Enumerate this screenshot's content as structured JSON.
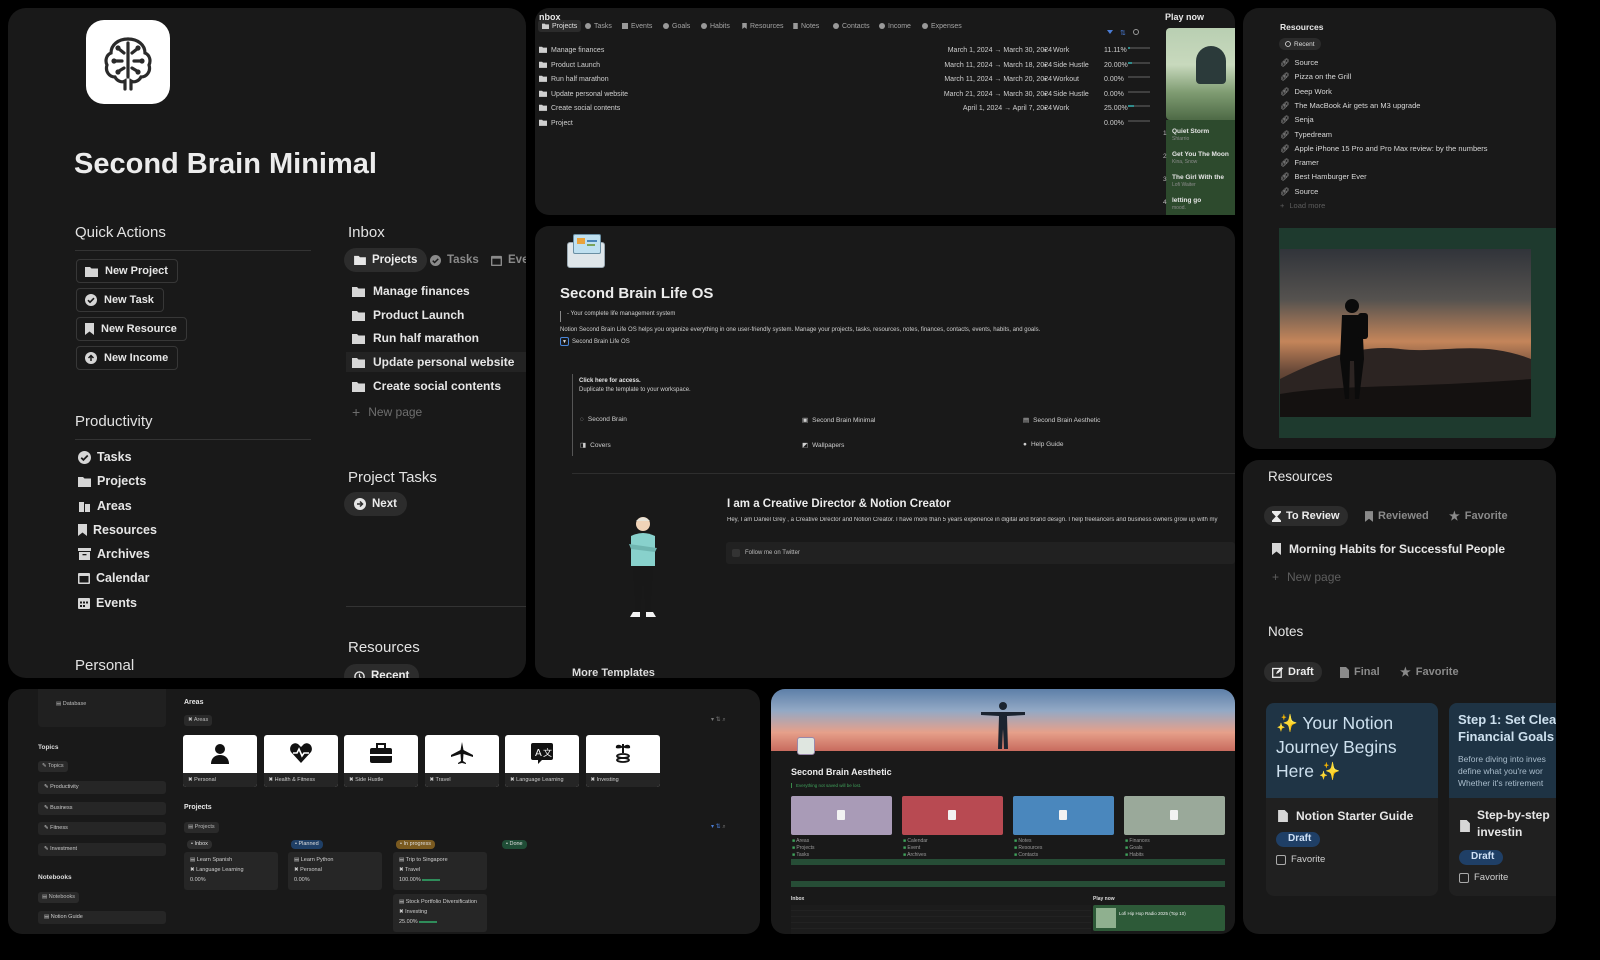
{
  "panel1": {
    "title": "Second Brain Minimal",
    "quick_actions": {
      "heading": "Quick Actions",
      "items": [
        "New Project",
        "New Task",
        "New Resource",
        "New Income"
      ]
    },
    "productivity": {
      "heading": "Productivity",
      "items": [
        "Tasks",
        "Projects",
        "Areas",
        "Resources",
        "Archives",
        "Calendar",
        "Events"
      ]
    },
    "personal_heading": "Personal",
    "inbox": {
      "heading": "Inbox",
      "tabs": [
        "Projects",
        "Tasks",
        "Ever"
      ],
      "items": [
        "Manage finances",
        "Product Launch",
        "Run half marathon",
        "Update personal website",
        "Create social contents"
      ],
      "new_page": "New page"
    },
    "project_tasks": {
      "heading": "Project Tasks",
      "button": "Next"
    },
    "resources": {
      "heading": "Resources",
      "button": "Recent"
    }
  },
  "panel2": {
    "title": "nbox",
    "tabs": [
      "Projects",
      "Tasks",
      "Events",
      "Goals",
      "Habits",
      "Resources",
      "Notes",
      "Contacts",
      "Income",
      "Expenses"
    ],
    "rows": [
      {
        "name": "Manage finances",
        "dates": "March 1, 2024 → March 30, 2024",
        "tag": "Work",
        "pct": "11.11%",
        "p": 11.11
      },
      {
        "name": "Product Launch",
        "dates": "March 11, 2024 → March 18, 2024",
        "tag": "Side Hustle",
        "pct": "20.00%",
        "p": 20
      },
      {
        "name": "Run half marathon",
        "dates": "March 11, 2024 → March 20, 2024",
        "tag": "Workout",
        "pct": "0.00%",
        "p": 0
      },
      {
        "name": "Update personal website",
        "dates": "March 21, 2024 → March 30, 2024",
        "tag": "Side Hustle",
        "pct": "0.00%",
        "p": 0
      },
      {
        "name": "Create social contents",
        "dates": "April 1, 2024 → April 7, 2024",
        "tag": "Work",
        "pct": "25.00%",
        "p": 25
      },
      {
        "name": "Project",
        "dates": "",
        "tag": "",
        "pct": "0.00%",
        "p": 0
      }
    ],
    "play_now": "Play now",
    "songs": [
      {
        "num": "1",
        "title": "Quiet Storm",
        "artist": "Shiarrio"
      },
      {
        "num": "2",
        "title": "Get You The Moon",
        "artist": "Kina, Snow"
      },
      {
        "num": "3",
        "title": "The Girl With the",
        "artist": "Lofi Waiter"
      },
      {
        "num": "4",
        "title": "letting go",
        "artist": "mood."
      }
    ]
  },
  "panel3": {
    "heading": "Resources",
    "button": "Recent",
    "items": [
      "Source",
      "Pizza on the Grill",
      "Deep Work",
      "The MacBook Air gets an M3 upgrade",
      "Senja",
      "Typedream",
      "Apple iPhone 15 Pro and Pro Max review: by the numbers",
      "Framer",
      "Best Hamburger Ever",
      "Source"
    ],
    "load_more": "Load more"
  },
  "panel4": {
    "title": "Second Brain Life OS",
    "subtitle": "- Your complete life management system",
    "description": "Notion Second Brain Life OS helps you organize everything in one user-friendly system. Manage your projects, tasks, resources, notes, finances, contacts, events, habits, and goals.",
    "toggle": "Second Brain Life OS",
    "access_title": "Click here for access.",
    "access_desc": "Duplicate the template to your workspace.",
    "links": [
      "Second Brain",
      "Second Brain Minimal",
      "Second Brain Aesthetic",
      "Covers",
      "Wallpapers",
      "Help Guide"
    ],
    "creator_title": "I am a Creative Director & Notion Creator",
    "creator_desc": "Hey, I am Daniel Grey , a Creative Director and Notion Creator. I have more than 5 years experience in digital and brand design. I help freelancers and business owners grow up with my",
    "follow": "Follow me on Twitter",
    "more": "More Templates"
  },
  "panel5": {
    "heading": "Resources",
    "tabs": [
      "To Review",
      "Reviewed",
      "Favorite"
    ],
    "item": "Morning Habits for Successful People",
    "new_page": "New page",
    "notes_heading": "Notes",
    "notes_tabs": [
      "Draft",
      "Final",
      "Favorite"
    ],
    "cards": [
      {
        "cover": "✨ Your Notion Journey Begins Here ✨",
        "title": "Notion Starter Guide",
        "status": "Draft",
        "fav": "Favorite"
      },
      {
        "cover": "Step 1: Set Clea Financial Goals",
        "cover_text": "Before diving into inves define what you're wor Whether it's retirement",
        "title": "Step-by-step investin",
        "status": "Draft",
        "fav": "Favorite"
      }
    ]
  },
  "panel6": {
    "sidebar": {
      "database": "Database",
      "topics_heading": "Topics",
      "topics_tag": "Topics",
      "topics": [
        "Productivity",
        "Business",
        "Fitness",
        "Investment"
      ],
      "notebooks_heading": "Notebooks",
      "notebooks_tag": "Notebooks",
      "notebook_item": "Notion Guide"
    },
    "areas": {
      "heading": "Areas",
      "tag": "Areas",
      "cards": [
        {
          "label": "Personal",
          "icon": "person-icon"
        },
        {
          "label": "Health & Fitness",
          "icon": "heart-pulse-icon"
        },
        {
          "label": "Side Hustle",
          "icon": "briefcase-icon"
        },
        {
          "label": "Travel",
          "icon": "airplane-icon"
        },
        {
          "label": "Language Learning",
          "icon": "translate-icon"
        },
        {
          "label": "Investing",
          "icon": "plant-coins-icon"
        }
      ]
    },
    "projects": {
      "heading": "Projects",
      "tag": "Projects",
      "columns": [
        {
          "name": "Inbox",
          "color": "#2e2e2e"
        },
        {
          "name": "Planned",
          "color": "#1f3f66"
        },
        {
          "name": "In progress",
          "color": "#7a5a20"
        },
        {
          "name": "Done",
          "color": "#1f4d36"
        }
      ],
      "cards": [
        {
          "col": 0,
          "title": "Learn Spanish",
          "area": "Language Learning",
          "pct": "0.00%"
        },
        {
          "col": 1,
          "title": "Learn Python",
          "area": "Personal",
          "pct": "0.00%"
        },
        {
          "col": 2,
          "title": "Trip to Singapore",
          "area": "Travel",
          "pct": "100.00%"
        },
        {
          "col": 2,
          "title": "Stock Portfolio Diversification",
          "area": "Investing",
          "pct": "25.00%"
        }
      ]
    }
  },
  "panel7": {
    "title": "Second Brain Aesthetic",
    "subtitle": "Everything not saved will be lost.",
    "swatches": [
      "#a99bb7",
      "#b84a52",
      "#4a87bd",
      "#9aa99a"
    ],
    "swatch_items": [
      [
        "Areas",
        "Projects",
        "Tasks"
      ],
      [
        "Calendar",
        "Event",
        "Archives"
      ],
      [
        "Notes",
        "Resources",
        "Contacts"
      ],
      [
        "Finances",
        "Goals",
        "Habits"
      ]
    ],
    "inbox_label": "Inbox",
    "play_now": "Play now",
    "song": "Lofi Hip Hop Radio 2025 (Top 10)"
  }
}
